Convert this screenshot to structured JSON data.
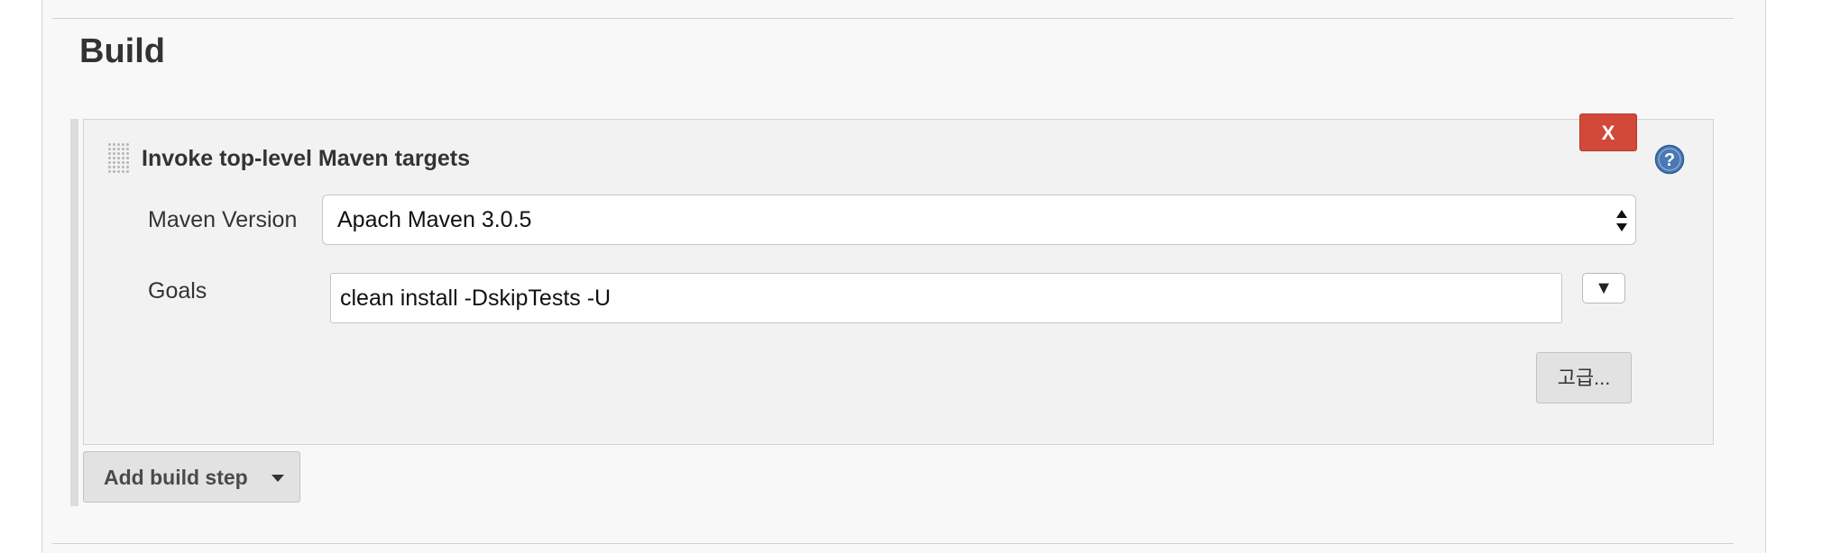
{
  "section": {
    "title": "Build"
  },
  "build_step": {
    "title": "Invoke top-level Maven targets",
    "delete_label": "X",
    "maven_version": {
      "label": "Maven Version",
      "selected": "Apach Maven 3.0.5"
    },
    "goals": {
      "label": "Goals",
      "value": "clean install -DskipTests -U",
      "expand_icon": "▼"
    },
    "advanced_label": "고급..."
  },
  "add_build_step": {
    "label": "Add build step"
  },
  "colors": {
    "delete_button": "#d24939",
    "help_icon": "#4a78b4",
    "background": "#f8f8f8",
    "card": "#f2f2f2"
  },
  "icons": {
    "help": "help-icon",
    "drag": "drag-handle-icon",
    "dropdown": "caret-down-icon",
    "select": "select-arrows-icon"
  }
}
